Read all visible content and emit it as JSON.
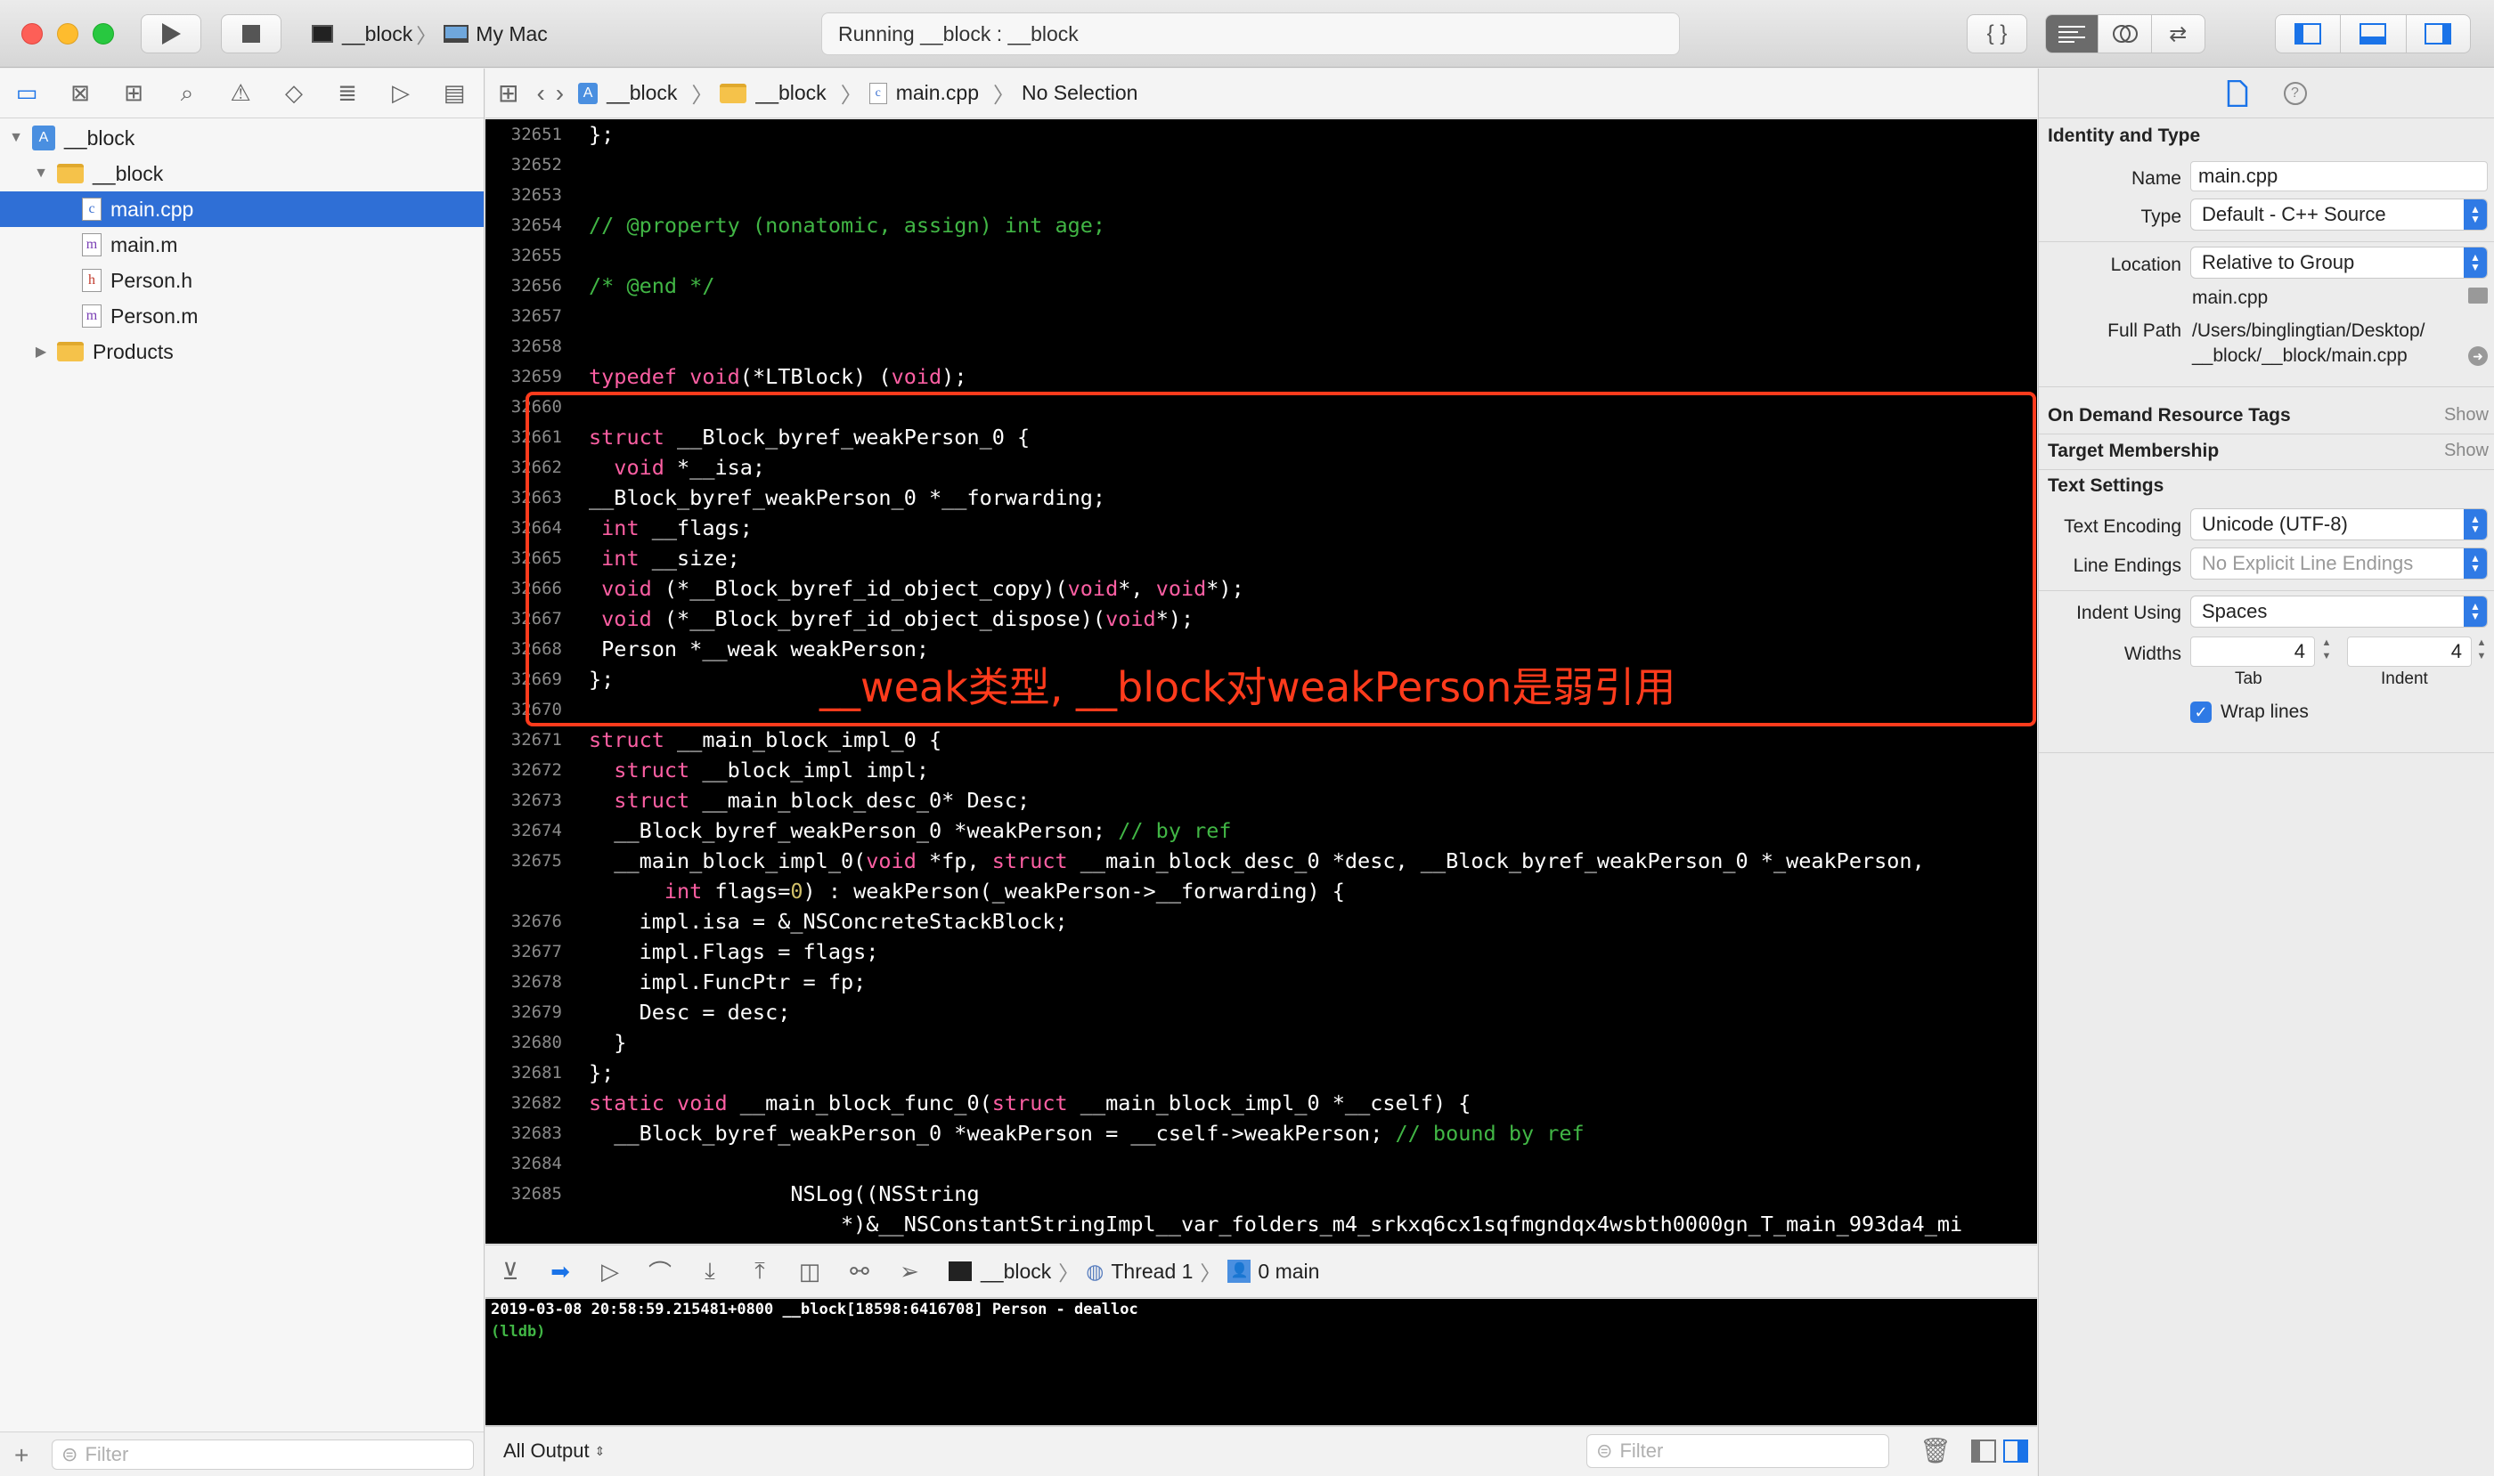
{
  "toolbar": {
    "scheme_target": "__block",
    "scheme_device": "My Mac",
    "activity": "Running __block : __block",
    "colors": {
      "close": "#fd5f57",
      "minimize": "#febc2e",
      "zoom": "#28c840",
      "accent": "#2f6fd6"
    }
  },
  "navigator": {
    "tree": [
      {
        "label": "__block",
        "kind": "project",
        "indent": 0,
        "disclosure": "▼"
      },
      {
        "label": "__block",
        "kind": "folder",
        "indent": 1,
        "disclosure": "▼"
      },
      {
        "label": "main.cpp",
        "kind": "file",
        "glyph": "c",
        "indent": 2,
        "selected": true
      },
      {
        "label": "main.m",
        "kind": "file",
        "glyph": "m",
        "indent": 2
      },
      {
        "label": "Person.h",
        "kind": "file",
        "glyph": "h",
        "indent": 2
      },
      {
        "label": "Person.m",
        "kind": "file",
        "glyph": "m",
        "indent": 2
      },
      {
        "label": "Products",
        "kind": "folder",
        "indent": 1,
        "disclosure": "▶"
      }
    ],
    "filter_placeholder": "Filter"
  },
  "jumpbar": {
    "crumbs": [
      "__block",
      "__block",
      "main.cpp",
      "No Selection"
    ]
  },
  "editor": {
    "lines": [
      {
        "n": "32651",
        "t": [
          [
            "p",
            "};"
          ]
        ]
      },
      {
        "n": "32652",
        "t": []
      },
      {
        "n": "32653",
        "t": []
      },
      {
        "n": "32654",
        "t": [
          [
            "c",
            "// @property (nonatomic, assign) int age;"
          ]
        ]
      },
      {
        "n": "32655",
        "t": []
      },
      {
        "n": "32656",
        "t": [
          [
            "c",
            "/* @end */"
          ]
        ]
      },
      {
        "n": "32657",
        "t": []
      },
      {
        "n": "32658",
        "t": []
      },
      {
        "n": "32659",
        "t": [
          [
            "k",
            "typedef"
          ],
          [
            "p",
            " "
          ],
          [
            "k",
            "void"
          ],
          [
            "p",
            "(*LTBlock) ("
          ],
          [
            "k",
            "void"
          ],
          [
            "p",
            ");"
          ]
        ]
      },
      {
        "n": "32660",
        "t": []
      },
      {
        "n": "32661",
        "t": [
          [
            "k",
            "struct"
          ],
          [
            "p",
            " __Block_byref_weakPerson_0 {"
          ]
        ]
      },
      {
        "n": "32662",
        "t": [
          [
            "p",
            "  "
          ],
          [
            "k",
            "void"
          ],
          [
            "p",
            " *__isa;"
          ]
        ]
      },
      {
        "n": "32663",
        "t": [
          [
            "p",
            "__Block_byref_weakPerson_0 *__forwarding;"
          ]
        ]
      },
      {
        "n": "32664",
        "t": [
          [
            "p",
            " "
          ],
          [
            "k",
            "int"
          ],
          [
            "p",
            " __flags;"
          ]
        ]
      },
      {
        "n": "32665",
        "t": [
          [
            "p",
            " "
          ],
          [
            "k",
            "int"
          ],
          [
            "p",
            " __size;"
          ]
        ]
      },
      {
        "n": "32666",
        "t": [
          [
            "p",
            " "
          ],
          [
            "k",
            "void"
          ],
          [
            "p",
            " (*__Block_byref_id_object_copy)("
          ],
          [
            "k",
            "void"
          ],
          [
            "p",
            "*, "
          ],
          [
            "k",
            "void"
          ],
          [
            "p",
            "*);"
          ]
        ]
      },
      {
        "n": "32667",
        "t": [
          [
            "p",
            " "
          ],
          [
            "k",
            "void"
          ],
          [
            "p",
            " (*__Block_byref_id_object_dispose)("
          ],
          [
            "k",
            "void"
          ],
          [
            "p",
            "*);"
          ]
        ]
      },
      {
        "n": "32668",
        "t": [
          [
            "p",
            " Person *__weak weakPerson;"
          ]
        ]
      },
      {
        "n": "32669",
        "t": [
          [
            "p",
            "};"
          ]
        ]
      },
      {
        "n": "32670",
        "t": []
      },
      {
        "n": "32671",
        "t": [
          [
            "k",
            "struct"
          ],
          [
            "p",
            " __main_block_impl_0 {"
          ]
        ]
      },
      {
        "n": "32672",
        "t": [
          [
            "p",
            "  "
          ],
          [
            "k",
            "struct"
          ],
          [
            "p",
            " __block_impl impl;"
          ]
        ]
      },
      {
        "n": "32673",
        "t": [
          [
            "p",
            "  "
          ],
          [
            "k",
            "struct"
          ],
          [
            "p",
            " __main_block_desc_0* Desc;"
          ]
        ]
      },
      {
        "n": "32674",
        "t": [
          [
            "p",
            "  __Block_byref_weakPerson_0 *weakPerson; "
          ],
          [
            "c",
            "// by ref"
          ]
        ]
      },
      {
        "n": "32675",
        "t": [
          [
            "p",
            "  __main_block_impl_0("
          ],
          [
            "k",
            "void"
          ],
          [
            "p",
            " *fp, "
          ],
          [
            "k",
            "struct"
          ],
          [
            "p",
            " __main_block_desc_0 *desc, __Block_byref_weakPerson_0 *_weakPerson,"
          ]
        ]
      },
      {
        "n": "",
        "t": [
          [
            "p",
            "      "
          ],
          [
            "k",
            "int"
          ],
          [
            "p",
            " flags="
          ],
          [
            "n",
            "0"
          ],
          [
            "p",
            ") : weakPerson(_weakPerson->__forwarding) {"
          ]
        ]
      },
      {
        "n": "32676",
        "t": [
          [
            "p",
            "    impl.isa = &_NSConcreteStackBlock;"
          ]
        ]
      },
      {
        "n": "32677",
        "t": [
          [
            "p",
            "    impl.Flags = flags;"
          ]
        ]
      },
      {
        "n": "32678",
        "t": [
          [
            "p",
            "    impl.FuncPtr = fp;"
          ]
        ]
      },
      {
        "n": "32679",
        "t": [
          [
            "p",
            "    Desc = desc;"
          ]
        ]
      },
      {
        "n": "32680",
        "t": [
          [
            "p",
            "  }"
          ]
        ]
      },
      {
        "n": "32681",
        "t": [
          [
            "p",
            "};"
          ]
        ]
      },
      {
        "n": "32682",
        "t": [
          [
            "k",
            "static"
          ],
          [
            "p",
            " "
          ],
          [
            "k",
            "void"
          ],
          [
            "p",
            " __main_block_func_0("
          ],
          [
            "k",
            "struct"
          ],
          [
            "p",
            " __main_block_impl_0 *__cself) {"
          ]
        ]
      },
      {
        "n": "32683",
        "t": [
          [
            "p",
            "  __Block_byref_weakPerson_0 *weakPerson = __cself->weakPerson; "
          ],
          [
            "c",
            "// bound by ref"
          ]
        ]
      },
      {
        "n": "32684",
        "t": []
      },
      {
        "n": "32685",
        "t": [
          [
            "p",
            "                NSLog((NSString"
          ]
        ]
      },
      {
        "n": "",
        "t": [
          [
            "p",
            "                    *)&__NSConstantStringImpl__var_folders_m4_srkxq6cx1sqfmgndqx4wsbth0000gn_T_main_993da4_mi"
          ]
        ]
      }
    ],
    "annotation": "__weak类型, __block对weakPerson是弱引用",
    "colors": {
      "keyword": "#fc5fa3",
      "comment": "#41b645",
      "number": "#d0bf69",
      "plain": "#ffffff",
      "highlight": "#ff3b1c"
    }
  },
  "debug": {
    "crumbs": [
      "__block",
      "Thread 1",
      "0 main"
    ],
    "console_lines": [
      {
        "text": "2019-03-08 20:58:59.215481+0800 __block[18598:6416708] Person - dealloc",
        "color": "#ffffff"
      },
      {
        "text": "(lldb)",
        "color": "#41b645"
      }
    ],
    "output_selector": "All Output",
    "filter_placeholder": "Filter"
  },
  "inspector": {
    "identity_title": "Identity and Type",
    "name_label": "Name",
    "name_value": "main.cpp",
    "type_label": "Type",
    "type_value": "Default - C++ Source",
    "location_label": "Location",
    "location_value": "Relative to Group",
    "location_file": "main.cpp",
    "fullpath_label": "Full Path",
    "fullpath_line1": "/Users/binglingtian/Desktop/",
    "fullpath_line2": "__block/__block/main.cpp",
    "odr_title": "On Demand Resource Tags",
    "odr_show": "Show",
    "target_title": "Target Membership",
    "target_show": "Show",
    "text_title": "Text Settings",
    "encoding_label": "Text Encoding",
    "encoding_value": "Unicode (UTF-8)",
    "endings_label": "Line Endings",
    "endings_value": "No Explicit Line Endings",
    "indent_label": "Indent Using",
    "indent_value": "Spaces",
    "widths_label": "Widths",
    "tab_value": "4",
    "indent_width_value": "4",
    "tab_caption": "Tab",
    "indent_caption": "Indent",
    "wrap_label": "Wrap lines",
    "wrap_checked": true
  }
}
